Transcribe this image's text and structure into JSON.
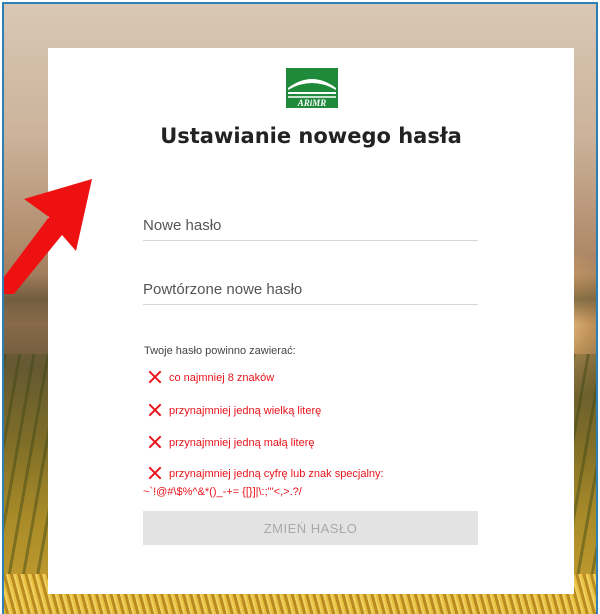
{
  "logo": {
    "text": "ARiMR"
  },
  "title": "Ustawianie nowego hasła",
  "fields": {
    "new_password_placeholder": "Nowe hasło",
    "repeat_password_placeholder": "Powtórzone nowe hasło"
  },
  "requirements": {
    "title": "Twoje hasło powinno zawierać:",
    "items": [
      "co najmniej 8 znaków",
      "przynajmniej jedną wielką literę",
      "przynajmniej jedną małą literę",
      "przynajmniej jedną cyfrę lub znak specjalny:"
    ],
    "special_chars": "~`!@#\\$%^&*()_-+= {[}]|\\:;\"'<,>.?/"
  },
  "submit_label": "ZMIEŃ HASŁO",
  "colors": {
    "error": "#e8141c",
    "logo_green": "#1e8a3a",
    "button_bg": "#e3e3e3",
    "arrow": "#ee1111"
  },
  "icons": [
    "close-icon",
    "arrow-pointer-icon"
  ]
}
